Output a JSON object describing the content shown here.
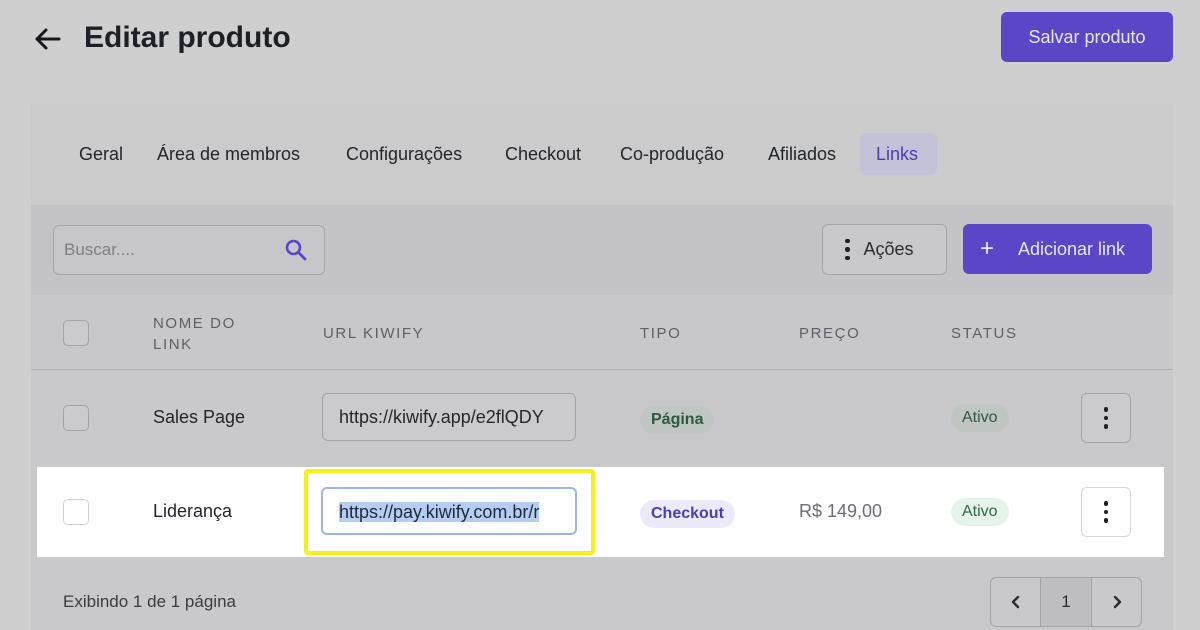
{
  "header": {
    "title": "Editar produto",
    "save_label": "Salvar produto"
  },
  "tabs": [
    {
      "label": "Geral",
      "active": false
    },
    {
      "label": "Área de membros",
      "active": false
    },
    {
      "label": "Configurações",
      "active": false
    },
    {
      "label": "Checkout",
      "active": false
    },
    {
      "label": "Co-produção",
      "active": false
    },
    {
      "label": "Afiliados",
      "active": false
    },
    {
      "label": "Links",
      "active": true
    }
  ],
  "toolbar": {
    "search_placeholder": "Buscar....",
    "actions_label": "Ações",
    "add_label": "Adicionar link"
  },
  "table": {
    "headers": {
      "name": "NOME DO LINK",
      "url": "URL KIWIFY",
      "type": "TIPO",
      "price": "PREÇO",
      "status": "STATUS"
    },
    "rows": [
      {
        "name": "Sales Page",
        "url": "https://kiwify.app/e2flQDY",
        "type": "Página",
        "price": "",
        "status": "Ativo"
      },
      {
        "name": "Liderança",
        "url": "https://pay.kiwify.com.br/r",
        "type": "Checkout",
        "price": "R$ 149,00",
        "status": "Ativo"
      }
    ]
  },
  "footer": {
    "pagination_text": "Exibindo 1 de 1 página",
    "current_page": "1"
  },
  "colors": {
    "accent": "#5a46c7",
    "highlight": "#f4f018"
  }
}
